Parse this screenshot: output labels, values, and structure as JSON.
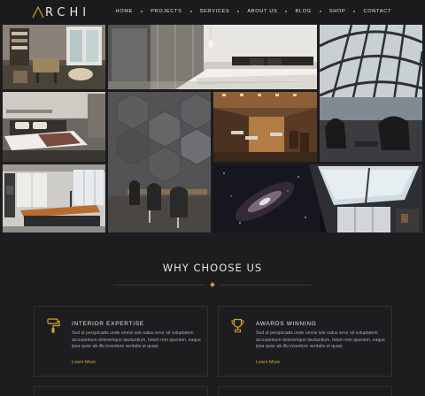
{
  "brand": {
    "logo_text": "RCHI",
    "logo_initial": "A",
    "accent": "#c9a227"
  },
  "nav": {
    "items": [
      "HOME",
      "PROJECTS",
      "SERVICES",
      "ABOUT US",
      "BLOG",
      "SHOP",
      "CONTACT"
    ]
  },
  "gallery": {
    "tiles": [
      "living-room",
      "white-bedroom",
      "glass-dome-lounge",
      "dark-bedroom",
      "hexagon-wall-office",
      "restaurant-interior",
      "kitchen",
      "galaxy-skylight"
    ]
  },
  "why_section": {
    "title": "WHY CHOOSE US",
    "cards": [
      {
        "icon": "paint-roller-icon",
        "title": "INTERIOR EXPERTISE",
        "text": "Sed ut perspiciatis unde omnis iste natus error sit voluptatem accusantium doloremque laudantium, totam rem aperiam, eaque ipsa quae ab illo inventore veritatis et quasi.",
        "link": "Learn More"
      },
      {
        "icon": "trophy-icon",
        "title": "AWARDS WINNING",
        "text": "Sed ut perspiciatis unde omnis iste natus error sit voluptatem accusantium doloremque laudantium, totam rem aperiam, eaque ipsa quae ab illo inventore veritatis et quasi.",
        "link": "Learn More"
      }
    ]
  }
}
